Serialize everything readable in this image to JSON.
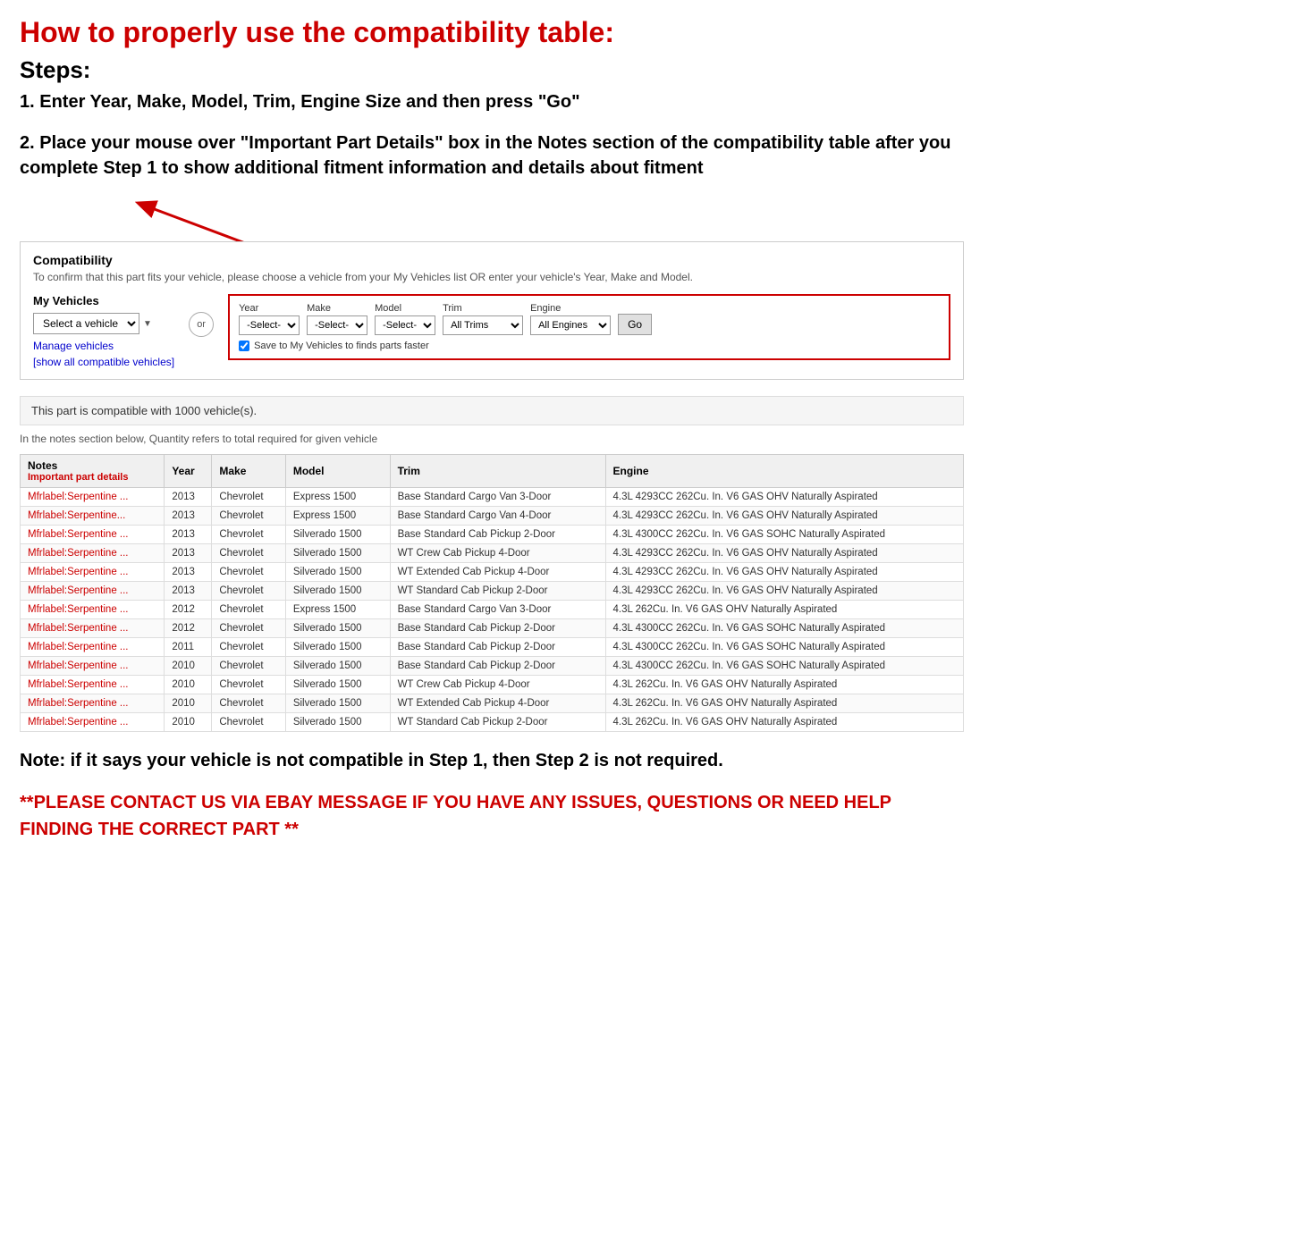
{
  "title": "How to properly use the compatibility table:",
  "steps_heading": "Steps:",
  "step1": "1. Enter Year, Make, Model, Trim, Engine Size and then press \"Go\"",
  "step2": "2. Place your mouse over \"Important Part Details\" box in the Notes section of the compatibility table after you complete Step 1 to show additional fitment information and details about fitment",
  "compat": {
    "title": "Compatibility",
    "subtitle": "To confirm that this part fits your vehicle, please choose a vehicle from your My Vehicles list OR enter your vehicle's Year, Make and Model.",
    "my_vehicles_label": "My Vehicles",
    "select_vehicle_placeholder": "Select a vehicle",
    "manage_vehicles": "Manage vehicles",
    "show_all": "[show all compatible vehicles]",
    "or_label": "or",
    "year_label": "Year",
    "year_value": "-Select-",
    "make_label": "Make",
    "make_value": "-Select-",
    "model_label": "Model",
    "model_value": "-Select-",
    "trim_label": "Trim",
    "trim_value": "All Trims",
    "engine_label": "Engine",
    "engine_value": "All Engines",
    "go_label": "Go",
    "save_label": "Save to My Vehicles to finds parts faster",
    "compatible_count": "This part is compatible with 1000 vehicle(s).",
    "quantity_note": "In the notes section below, Quantity refers to total required for given vehicle",
    "table_headers": [
      "Notes",
      "Year",
      "Make",
      "Model",
      "Trim",
      "Engine"
    ],
    "table_rows": [
      {
        "notes": "Mfrlabel:Serpentine ...",
        "year": "2013",
        "make": "Chevrolet",
        "model": "Express 1500",
        "trim": "Base Standard Cargo Van 3-Door",
        "engine": "4.3L 4293CC 262Cu. In. V6 GAS OHV Naturally Aspirated"
      },
      {
        "notes": "Mfrlabel:Serpentine...",
        "year": "2013",
        "make": "Chevrolet",
        "model": "Express 1500",
        "trim": "Base Standard Cargo Van 4-Door",
        "engine": "4.3L 4293CC 262Cu. In. V6 GAS OHV Naturally Aspirated"
      },
      {
        "notes": "Mfrlabel:Serpentine ...",
        "year": "2013",
        "make": "Chevrolet",
        "model": "Silverado 1500",
        "trim": "Base Standard Cab Pickup 2-Door",
        "engine": "4.3L 4300CC 262Cu. In. V6 GAS SOHC Naturally Aspirated"
      },
      {
        "notes": "Mfrlabel:Serpentine ...",
        "year": "2013",
        "make": "Chevrolet",
        "model": "Silverado 1500",
        "trim": "WT Crew Cab Pickup 4-Door",
        "engine": "4.3L 4293CC 262Cu. In. V6 GAS OHV Naturally Aspirated"
      },
      {
        "notes": "Mfrlabel:Serpentine ...",
        "year": "2013",
        "make": "Chevrolet",
        "model": "Silverado 1500",
        "trim": "WT Extended Cab Pickup 4-Door",
        "engine": "4.3L 4293CC 262Cu. In. V6 GAS OHV Naturally Aspirated"
      },
      {
        "notes": "Mfrlabel:Serpentine ...",
        "year": "2013",
        "make": "Chevrolet",
        "model": "Silverado 1500",
        "trim": "WT Standard Cab Pickup 2-Door",
        "engine": "4.3L 4293CC 262Cu. In. V6 GAS OHV Naturally Aspirated"
      },
      {
        "notes": "Mfrlabel:Serpentine ...",
        "year": "2012",
        "make": "Chevrolet",
        "model": "Express 1500",
        "trim": "Base Standard Cargo Van 3-Door",
        "engine": "4.3L 262Cu. In. V6 GAS OHV Naturally Aspirated"
      },
      {
        "notes": "Mfrlabel:Serpentine ...",
        "year": "2012",
        "make": "Chevrolet",
        "model": "Silverado 1500",
        "trim": "Base Standard Cab Pickup 2-Door",
        "engine": "4.3L 4300CC 262Cu. In. V6 GAS SOHC Naturally Aspirated"
      },
      {
        "notes": "Mfrlabel:Serpentine ...",
        "year": "2011",
        "make": "Chevrolet",
        "model": "Silverado 1500",
        "trim": "Base Standard Cab Pickup 2-Door",
        "engine": "4.3L 4300CC 262Cu. In. V6 GAS SOHC Naturally Aspirated"
      },
      {
        "notes": "Mfrlabel:Serpentine ...",
        "year": "2010",
        "make": "Chevrolet",
        "model": "Silverado 1500",
        "trim": "Base Standard Cab Pickup 2-Door",
        "engine": "4.3L 4300CC 262Cu. In. V6 GAS SOHC Naturally Aspirated"
      },
      {
        "notes": "Mfrlabel:Serpentine ...",
        "year": "2010",
        "make": "Chevrolet",
        "model": "Silverado 1500",
        "trim": "WT Crew Cab Pickup 4-Door",
        "engine": "4.3L 262Cu. In. V6 GAS OHV Naturally Aspirated"
      },
      {
        "notes": "Mfrlabel:Serpentine ...",
        "year": "2010",
        "make": "Chevrolet",
        "model": "Silverado 1500",
        "trim": "WT Extended Cab Pickup 4-Door",
        "engine": "4.3L 262Cu. In. V6 GAS OHV Naturally Aspirated"
      },
      {
        "notes": "Mfrlabel:Serpentine ...",
        "year": "2010",
        "make": "Chevrolet",
        "model": "Silverado 1500",
        "trim": "WT Standard Cab Pickup 2-Door",
        "engine": "4.3L 262Cu. In. V6 GAS OHV Naturally Aspirated"
      }
    ]
  },
  "note": "Note: if it says your vehicle is not compatible in Step 1, then Step 2 is not required.",
  "contact": "**PLEASE CONTACT US VIA EBAY MESSAGE IF YOU HAVE ANY ISSUES, QUESTIONS OR NEED HELP FINDING THE CORRECT PART **"
}
